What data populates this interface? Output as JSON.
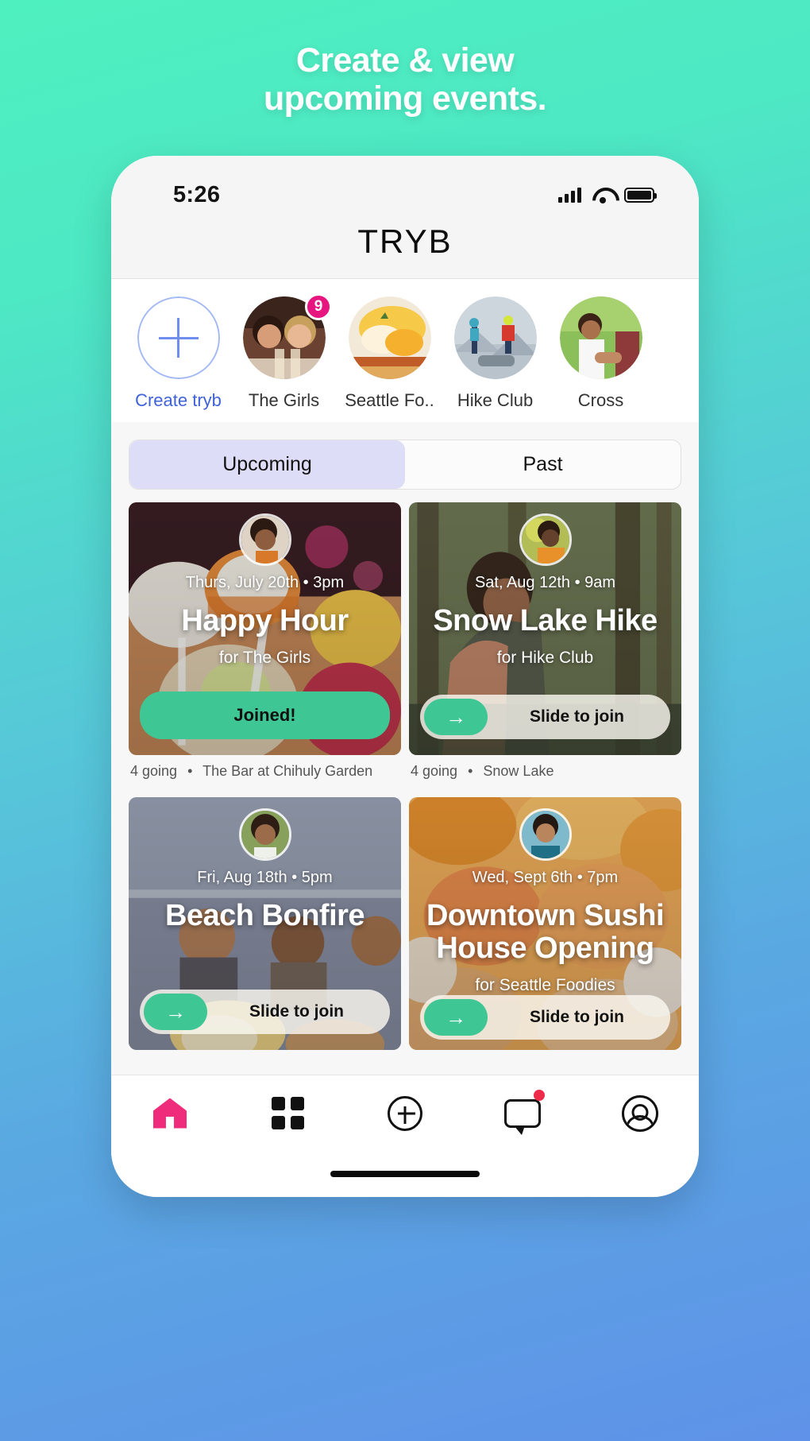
{
  "headline": {
    "line1": "Create & view",
    "line2": "upcoming events."
  },
  "phone": {
    "status": {
      "time": "5:26",
      "signal_icon": "cellular-signal-icon",
      "wifi_icon": "wifi-icon",
      "battery_icon": "battery-icon"
    },
    "app_title": "TRYB"
  },
  "trybs": [
    {
      "label": "Create tryb",
      "type": "create",
      "icon": "plus-icon"
    },
    {
      "label": "The Girls",
      "badge": "9"
    },
    {
      "label": "Seattle Fo.."
    },
    {
      "label": "Hike Club"
    },
    {
      "label": "Cross"
    }
  ],
  "tabs": [
    {
      "label": "Upcoming",
      "active": true
    },
    {
      "label": "Past",
      "active": false
    }
  ],
  "events": [
    {
      "date": "Thurs, July 20th • 3pm",
      "title": "Happy Hour",
      "for": "for The Girls",
      "cta": "Joined!",
      "cta_type": "joined",
      "going": "4 going",
      "location": "The Bar at Chihuly Garden"
    },
    {
      "date": "Sat, Aug 12th • 9am",
      "title": "Snow Lake Hike",
      "for": "for Hike Club",
      "cta": "Slide to join",
      "cta_type": "slide",
      "going": "4 going",
      "location": "Snow Lake"
    },
    {
      "date": "Fri, Aug 18th • 5pm",
      "title": "Beach Bonfire",
      "for": "",
      "cta": "Slide to join",
      "cta_type": "slide",
      "going": "",
      "location": ""
    },
    {
      "date": "Wed, Sept 6th • 7pm",
      "title": "Downtown Sushi House Opening",
      "for": "for Seattle Foodies",
      "cta": "Slide to join",
      "cta_type": "slide",
      "going": "",
      "location": ""
    }
  ],
  "tabbar": [
    {
      "icon": "home-icon",
      "active": true
    },
    {
      "icon": "grid-icon",
      "active": false
    },
    {
      "icon": "plus-circle-icon",
      "active": false
    },
    {
      "icon": "chat-icon",
      "active": false,
      "dot": true
    },
    {
      "icon": "profile-icon",
      "active": false
    }
  ],
  "colors": {
    "accent_green": "#3ec795",
    "accent_pink": "#ef2b7b",
    "badge_pink": "#e6157f",
    "tab_active": "#ddddf8",
    "create_blue": "#3f62d8"
  }
}
